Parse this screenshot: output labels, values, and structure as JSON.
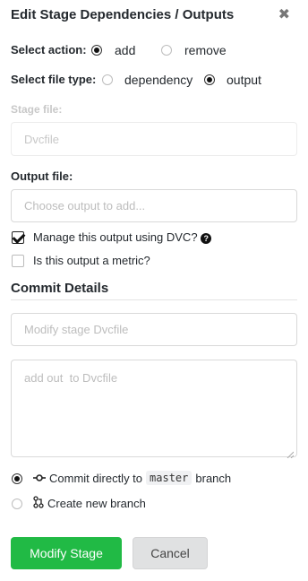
{
  "dialog": {
    "title": "Edit Stage Dependencies / Outputs",
    "close_icon": "close-icon"
  },
  "action": {
    "label": "Select action:",
    "options": [
      {
        "label": "add",
        "selected": true
      },
      {
        "label": "remove",
        "selected": false
      }
    ]
  },
  "file_type": {
    "label": "Select file type:",
    "options": [
      {
        "label": "dependency",
        "selected": false
      },
      {
        "label": "output",
        "selected": true
      }
    ]
  },
  "stage_file": {
    "label": "Stage file:",
    "placeholder": "Dvcfile",
    "disabled": true
  },
  "output_file": {
    "label": "Output file:",
    "placeholder": "Choose output to add..."
  },
  "checkboxes": [
    {
      "label": "Manage this output using DVC?",
      "checked": true,
      "icon": "help-icon"
    },
    {
      "label": "Is this output a metric?",
      "checked": false
    }
  ],
  "commit": {
    "section_title": "Commit Details",
    "message_placeholder": "Modify stage Dvcfile",
    "description_placeholder": "add out  to Dvcfile",
    "options": [
      {
        "label_prefix": "Commit directly to",
        "branch": "master",
        "label_suffix": "branch",
        "selected": true,
        "icon": "git-commit-icon"
      },
      {
        "label": "Create new branch",
        "selected": false,
        "icon": "git-pull-request-icon"
      }
    ]
  },
  "buttons": {
    "primary": "Modify Stage",
    "secondary": "Cancel",
    "primary_color": "#21ba45"
  }
}
